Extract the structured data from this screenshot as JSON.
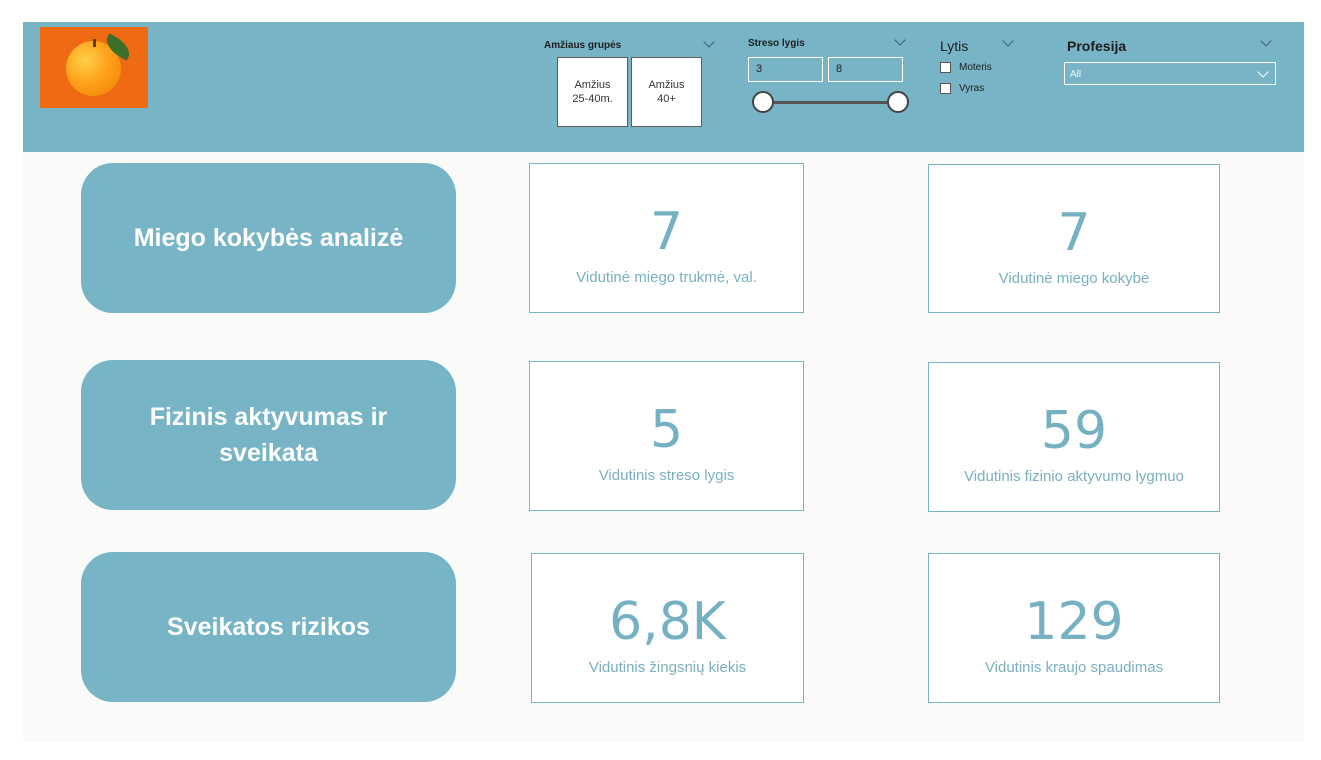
{
  "filters": {
    "age_group": {
      "title": "Amžiaus grupės",
      "options": [
        "Amžius\n25-40m.",
        "Amžius\n40+"
      ]
    },
    "stress": {
      "title": "Streso lygis",
      "min": "3",
      "max": "8",
      "range": [
        3,
        8
      ]
    },
    "gender": {
      "title": "Lytis",
      "options": [
        "Moteris",
        "Vyras"
      ]
    },
    "profession": {
      "title": "Profesija",
      "selected": "All"
    }
  },
  "sections": [
    {
      "label": "Miego kokybės analizė"
    },
    {
      "label": "Fizinis aktyvumas ir sveikata"
    },
    {
      "label": "Sveikatos rizikos"
    }
  ],
  "cards": [
    {
      "value": "7",
      "label": "Vidutinė miego trukmė, val."
    },
    {
      "value": "7",
      "label": "Vidutinė miego kokybė"
    },
    {
      "value": "5",
      "label": "Vidutinis streso lygis"
    },
    {
      "value": "59",
      "label": "Vidutinis fizinio aktyvumo lygmuo"
    },
    {
      "value": "6,8K",
      "label": "Vidutinis žingsnių kiekis"
    },
    {
      "value": "129",
      "label": "Vidutinis kraujo spaudimas"
    }
  ]
}
